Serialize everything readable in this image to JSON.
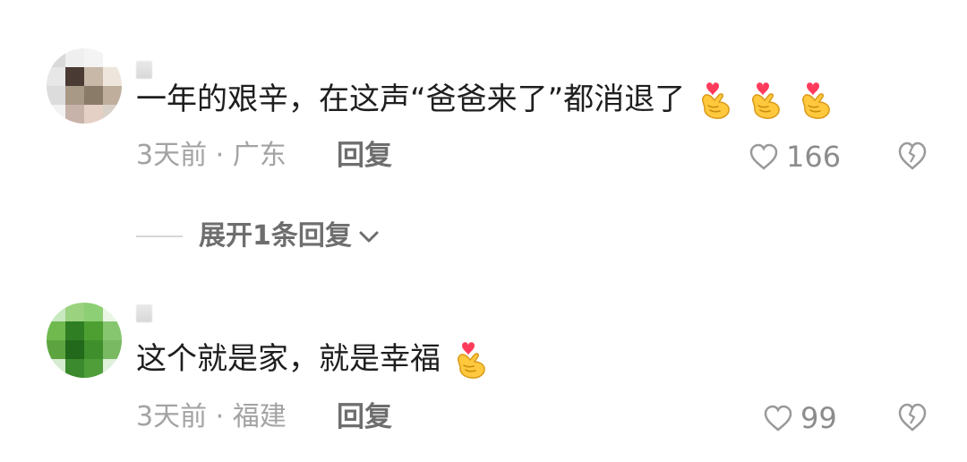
{
  "comments": [
    {
      "text": "一年的艰辛，在这声“爸爸来了”都消退了",
      "emoji": "heart-hand-emoji",
      "emoji_count": 3,
      "meta": "3天前 · 广东",
      "reply_label": "回复",
      "likes": "166",
      "expand_replies": "展开1条回复"
    },
    {
      "text": "这个就是家，就是幸福",
      "emoji": "heart-hand-emoji",
      "emoji_count": 1,
      "meta": "3天前 · 福建",
      "reply_label": "回复",
      "likes": "99"
    }
  ],
  "colors": {
    "text": "#1e1e1e",
    "meta": "#a3a3a3",
    "action": "#6e6e6e",
    "heart_emoji": "#ff3b5c",
    "hand_emoji": "#ffc83d"
  }
}
